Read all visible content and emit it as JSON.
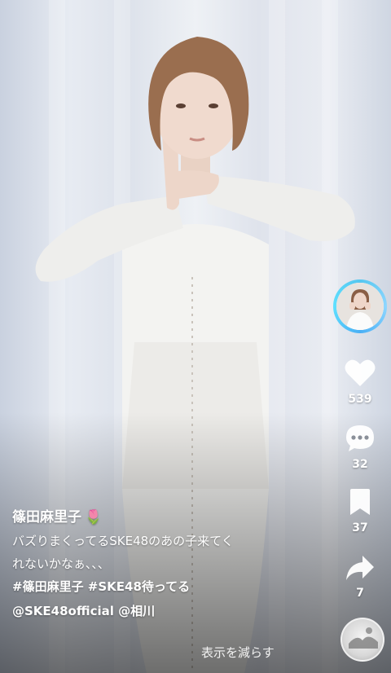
{
  "post": {
    "author": "篠田麻里子",
    "author_emoji": "🌷",
    "description_line1": "バズりまくってるSKE48のあの子来てく",
    "description_line2": "れないかなぁ、、、",
    "hashtags": "#篠田麻里子 #SKE48待ってる",
    "mentions": "@SKE48official @相川",
    "show_less": "表示を減らす"
  },
  "actions": {
    "likes": "539",
    "comments": "32",
    "saves": "37",
    "shares": "7"
  },
  "icons": {
    "like": "heart-icon",
    "comment": "comment-bubble-icon",
    "save": "bookmark-icon",
    "share": "share-arrow-icon",
    "sound": "sound-disc-icon"
  },
  "colors": {
    "avatar_ring": "#55c7f0",
    "text": "#ffffff"
  }
}
